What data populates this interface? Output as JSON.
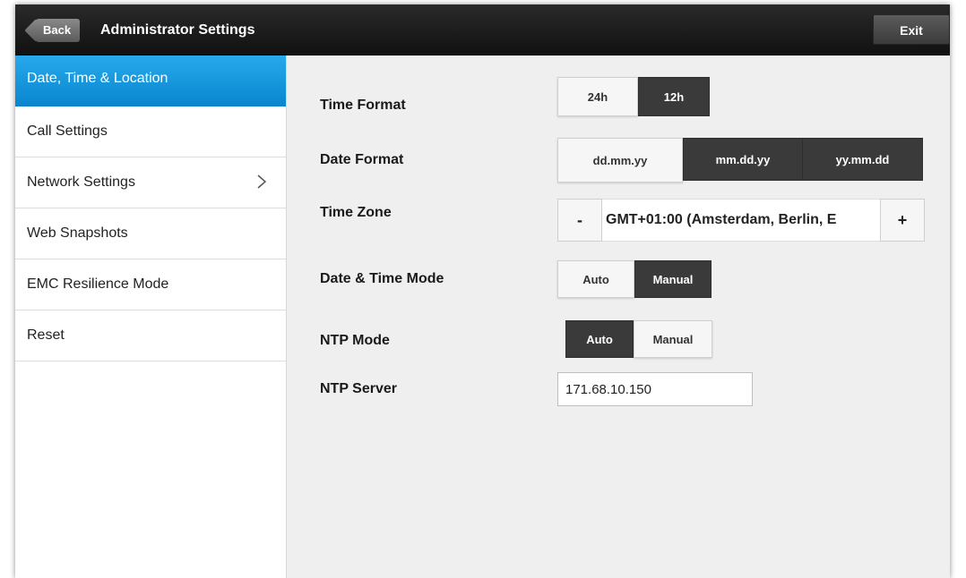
{
  "header": {
    "back_label": "Back",
    "title": "Administrator Settings",
    "exit_label": "Exit"
  },
  "sidebar": {
    "items": [
      {
        "label": "Date, Time & Location",
        "active": true
      },
      {
        "label": "Call Settings"
      },
      {
        "label": "Network Settings",
        "has_submenu": true
      },
      {
        "label": "Web Snapshots"
      },
      {
        "label": "EMC Resilience Mode"
      },
      {
        "label": "Reset"
      }
    ]
  },
  "settings": {
    "time_format": {
      "label": "Time Format",
      "options": [
        "24h",
        "12h"
      ],
      "selected": "12h"
    },
    "date_format": {
      "label": "Date Format",
      "options": [
        "dd.mm.yy",
        "mm.dd.yy",
        "yy.mm.dd"
      ],
      "selected": "mm.dd.yy"
    },
    "time_zone": {
      "label": "Time Zone",
      "minus": "-",
      "value": "GMT+01:00 (Amsterdam, Berlin, E",
      "plus": "+"
    },
    "date_time_mode": {
      "label": "Date & Time Mode",
      "options": [
        "Auto",
        "Manual"
      ],
      "selected": "Manual"
    },
    "ntp_mode": {
      "label": "NTP Mode",
      "options": [
        "Auto",
        "Manual"
      ],
      "selected": "Auto"
    },
    "ntp_server": {
      "label": "NTP Server",
      "value": "171.68.10.150"
    }
  },
  "colors": {
    "accent": "#1a99e0",
    "selected_segment": "#3a3a3a",
    "topbar": "#1c1c1c"
  },
  "icons": {
    "submenu": "chevron-right-icon"
  }
}
